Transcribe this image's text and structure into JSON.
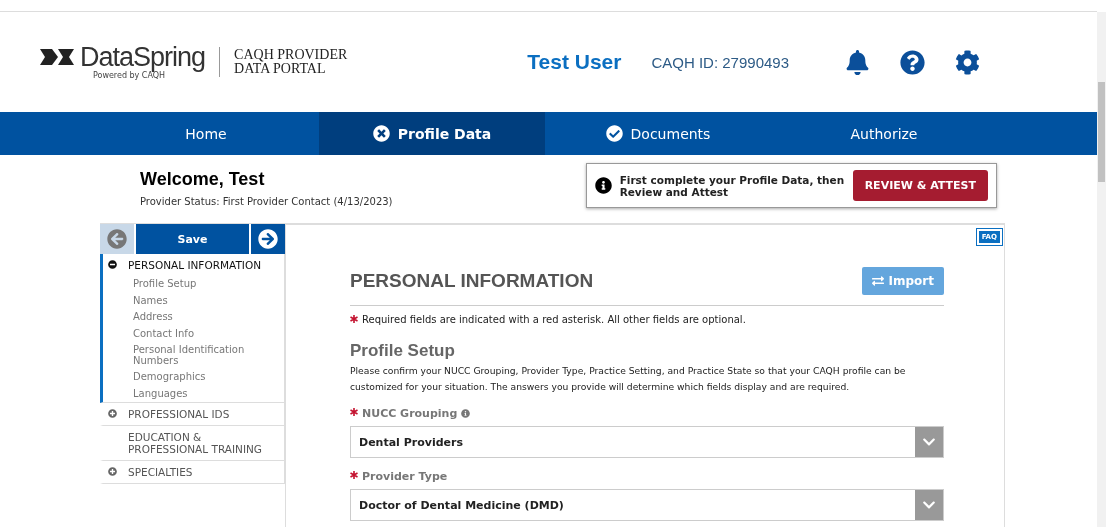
{
  "header": {
    "logo_name": "DataSpring",
    "logo_tagline": "Powered by CAQH",
    "portal_name": [
      "CAQH PROVIDER",
      "DATA PORTAL"
    ],
    "user": "Test User",
    "caqh_id": "CAQH ID: 27990493"
  },
  "tabs": [
    {
      "label": "Home",
      "selected": false
    },
    {
      "label": "Profile Data",
      "selected": true,
      "kind": "incomplete"
    },
    {
      "label": "Documents",
      "selected": false,
      "kind": "complete"
    },
    {
      "label": "Authorize",
      "selected": false
    }
  ],
  "welcome": {
    "title": "Welcome, Test",
    "status_label": "Provider Status:",
    "status_value": "First Provider Contact (4/13/2023)"
  },
  "notice": {
    "text": "First complete your Profile Data, then Review and Attest",
    "button": "REVIEW & ATTEST"
  },
  "sidebar": {
    "save": "Save",
    "sections": [
      {
        "label": "PERSONAL INFORMATION",
        "expanded": true,
        "children": [
          {
            "label": "Profile Setup"
          },
          {
            "label": "Names"
          },
          {
            "label": "Address"
          },
          {
            "label": "Contact Info"
          },
          {
            "label": "Personal Identification Numbers"
          },
          {
            "label": "Demographics"
          },
          {
            "label": "Languages"
          }
        ]
      },
      {
        "label": "PROFESSIONAL IDS",
        "expanded": false
      },
      {
        "label": "EDUCATION & PROFESSIONAL TRAINING"
      },
      {
        "label": "SPECIALTIES",
        "expanded": false
      }
    ]
  },
  "main": {
    "faq": "FAQ",
    "title": "PERSONAL INFORMATION",
    "import": "Import",
    "required_note": "Required fields are indicated with a red asterisk. All other fields are optional.",
    "section_title": "Profile Setup",
    "description": "Please confirm your NUCC Grouping, Provider Type, Practice Setting, and Practice State so that your CAQH profile can be customized for your situation. The answers you provide will determine which fields display and are required.",
    "fields": [
      {
        "label": "NUCC Grouping",
        "required": true,
        "info": true,
        "value": "Dental Providers"
      },
      {
        "label": "Provider Type",
        "required": true,
        "info": false,
        "value": "Doctor of Dental Medicine (DMD)"
      }
    ]
  }
}
